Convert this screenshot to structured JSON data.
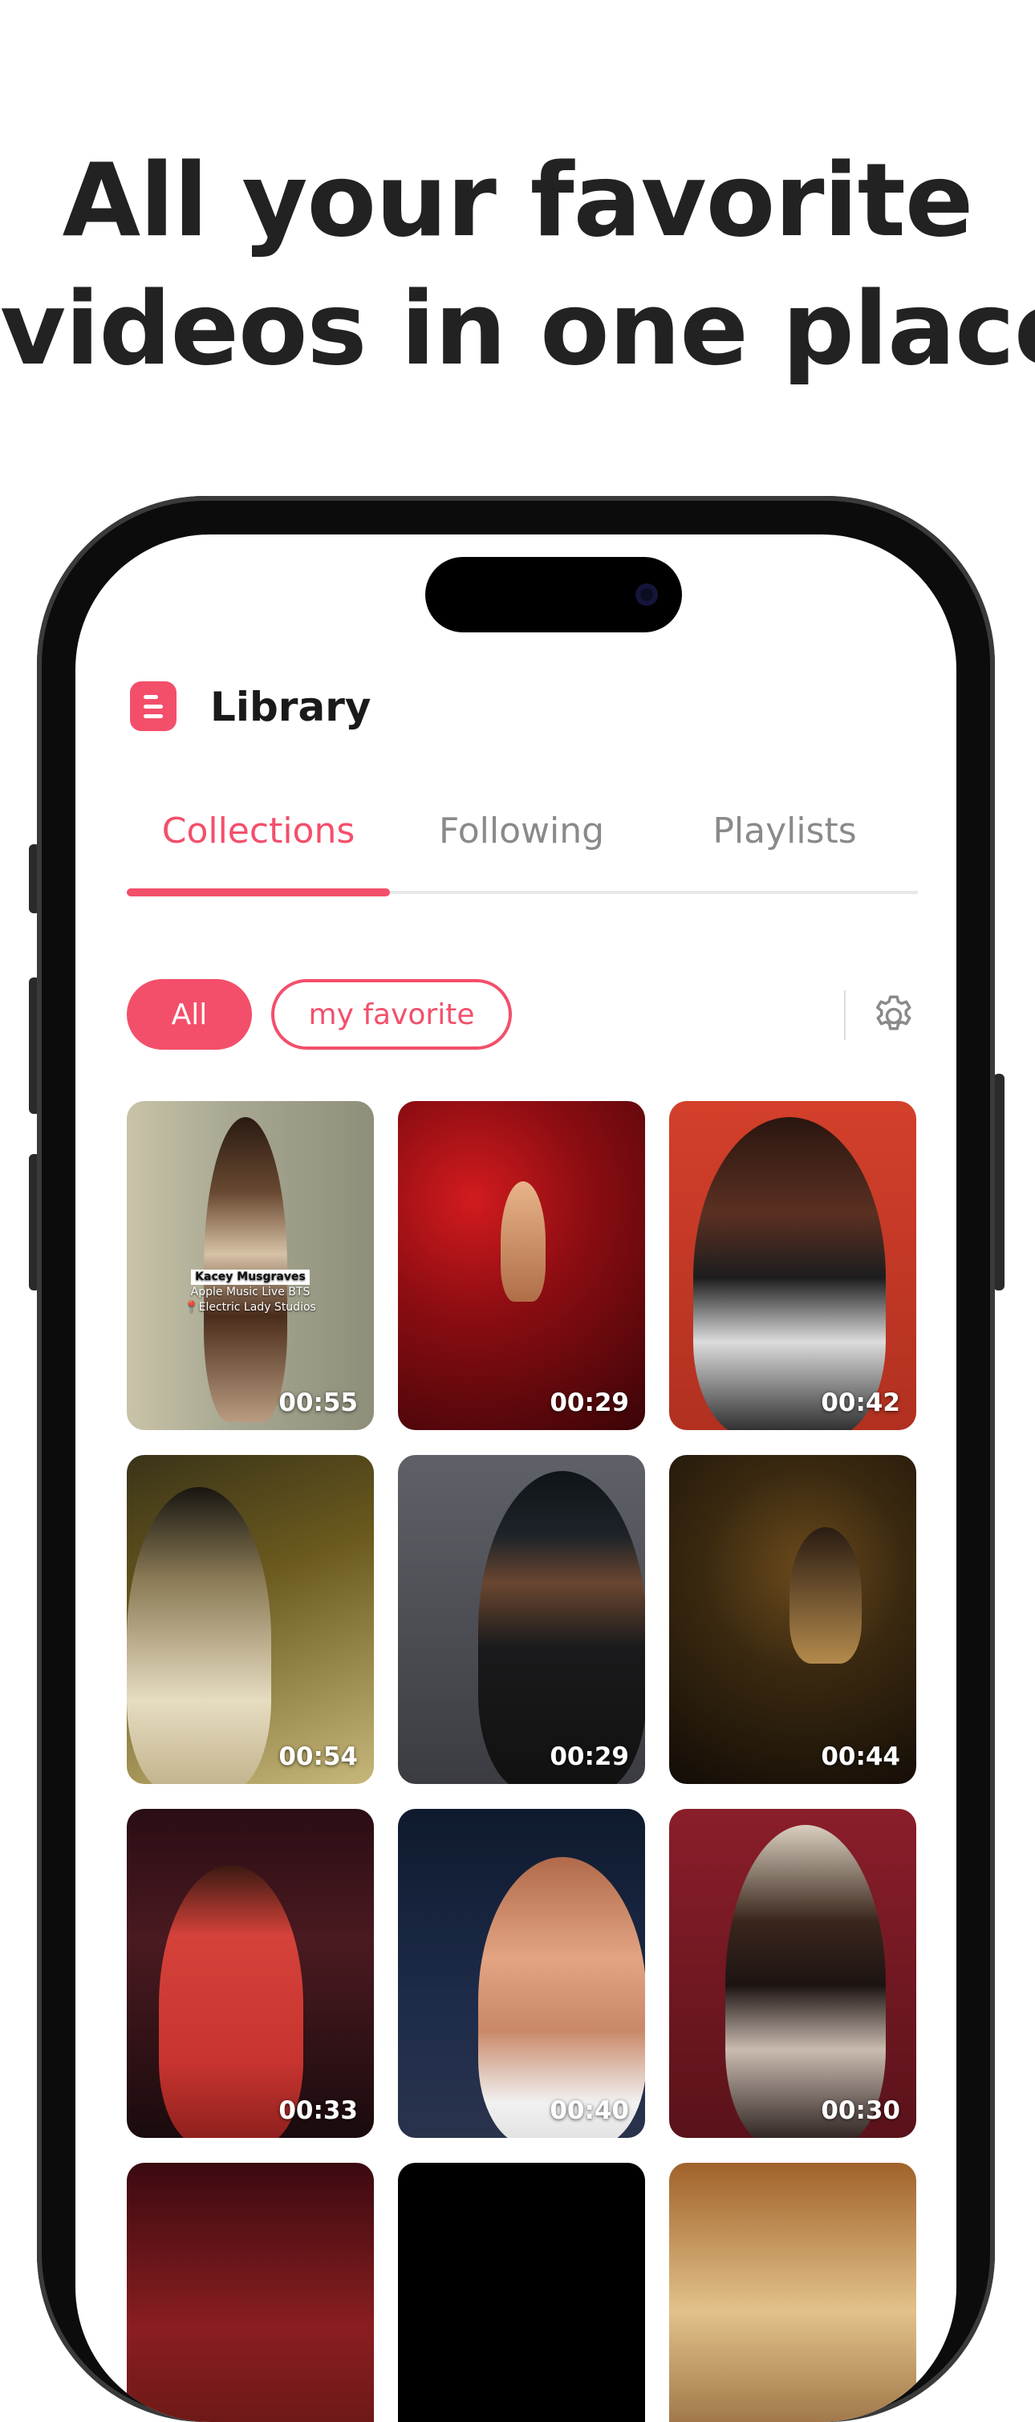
{
  "headline": {
    "line1": "All your favorite",
    "line2": "videos in one place"
  },
  "app": {
    "title": "Library",
    "logo_icon": "list-icon",
    "accent": "#f34f6b"
  },
  "tabs": [
    {
      "label": "Collections",
      "active": true
    },
    {
      "label": "Following",
      "active": false
    },
    {
      "label": "Playlists",
      "active": false
    }
  ],
  "filters": [
    {
      "label": "All",
      "selected": true
    },
    {
      "label": "my favorite",
      "selected": false
    }
  ],
  "settings_icon": "gear-icon",
  "videos": [
    {
      "duration": "00:55",
      "overlay": {
        "title": "Kacey Musgraves",
        "line2": "Apple Music Live BTS",
        "line3": "📍Electric Lady Studios"
      }
    },
    {
      "duration": "00:29"
    },
    {
      "duration": "00:42"
    },
    {
      "duration": "00:54"
    },
    {
      "duration": "00:29"
    },
    {
      "duration": "00:44"
    },
    {
      "duration": "00:33"
    },
    {
      "duration": "00:40"
    },
    {
      "duration": "00:30"
    }
  ]
}
